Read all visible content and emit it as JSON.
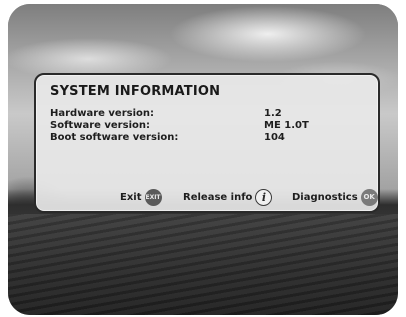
{
  "dialog": {
    "title": "SYSTEM INFORMATION",
    "rows": [
      {
        "label": "Hardware version:",
        "value": "1.2"
      },
      {
        "label": "Software version:",
        "value": "ME 1.0T"
      },
      {
        "label": "Boot software version:",
        "value": "104"
      }
    ]
  },
  "actions": {
    "exit": {
      "label": "Exit",
      "key": "EXIT"
    },
    "release_info": {
      "label": "Release info",
      "key": "i"
    },
    "diagnostics": {
      "label": "Diagnostics",
      "key": "OK"
    }
  },
  "colors": {
    "panel": "#e8e8e8",
    "text": "#1e1e1e",
    "key_button": "#5a5a5a"
  }
}
